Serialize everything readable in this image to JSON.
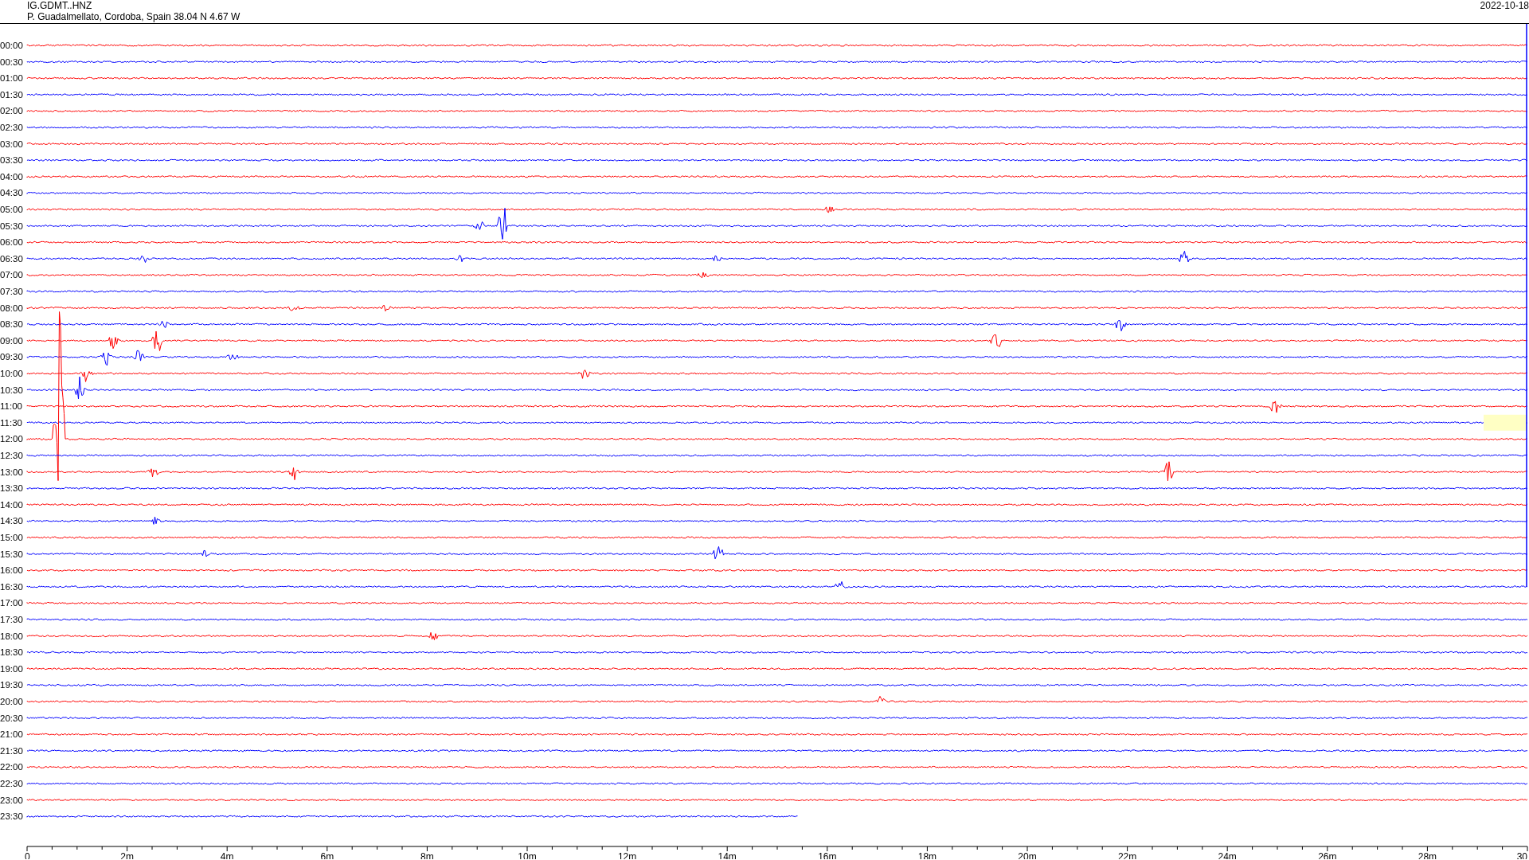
{
  "header": {
    "station": "IG.GDMT..HNZ",
    "location": "P. Guadalmellato, Cordoba, Spain  38.04 N 4.67 W",
    "date": "2022-10-18"
  },
  "rows": [
    {
      "label": "00:00",
      "color": "#ff0000"
    },
    {
      "label": "00:30",
      "color": "#0000ff"
    },
    {
      "label": "01:00",
      "color": "#ff0000"
    },
    {
      "label": "01:30",
      "color": "#0000ff"
    },
    {
      "label": "02:00",
      "color": "#ff0000"
    },
    {
      "label": "02:30",
      "color": "#0000ff"
    },
    {
      "label": "03:00",
      "color": "#ff0000"
    },
    {
      "label": "03:30",
      "color": "#0000ff"
    },
    {
      "label": "04:00",
      "color": "#ff0000"
    },
    {
      "label": "04:30",
      "color": "#0000ff"
    },
    {
      "label": "05:00",
      "color": "#ff0000"
    },
    {
      "label": "05:30",
      "color": "#0000ff"
    },
    {
      "label": "06:00",
      "color": "#ff0000"
    },
    {
      "label": "06:30",
      "color": "#0000ff"
    },
    {
      "label": "07:00",
      "color": "#ff0000"
    },
    {
      "label": "07:30",
      "color": "#0000ff"
    },
    {
      "label": "08:00",
      "color": "#ff0000"
    },
    {
      "label": "08:30",
      "color": "#0000ff"
    },
    {
      "label": "09:00",
      "color": "#ff0000"
    },
    {
      "label": "09:30",
      "color": "#0000ff"
    },
    {
      "label": "10:00",
      "color": "#ff0000"
    },
    {
      "label": "10:30",
      "color": "#0000ff"
    },
    {
      "label": "11:00",
      "color": "#ff0000"
    },
    {
      "label": "11:30",
      "color": "#0000ff"
    },
    {
      "label": "12:00",
      "color": "#ff0000"
    },
    {
      "label": "12:30",
      "color": "#0000ff"
    },
    {
      "label": "13:00",
      "color": "#ff0000"
    },
    {
      "label": "13:30",
      "color": "#0000ff"
    },
    {
      "label": "14:00",
      "color": "#ff0000"
    },
    {
      "label": "14:30",
      "color": "#0000ff"
    },
    {
      "label": "15:00",
      "color": "#ff0000"
    },
    {
      "label": "15:30",
      "color": "#0000ff"
    },
    {
      "label": "16:00",
      "color": "#ff0000"
    },
    {
      "label": "16:30",
      "color": "#0000ff"
    },
    {
      "label": "17:00",
      "color": "#ff0000"
    },
    {
      "label": "17:30",
      "color": "#0000ff"
    },
    {
      "label": "18:00",
      "color": "#ff0000"
    },
    {
      "label": "18:30",
      "color": "#0000ff"
    },
    {
      "label": "19:00",
      "color": "#ff0000"
    },
    {
      "label": "19:30",
      "color": "#0000ff"
    },
    {
      "label": "20:00",
      "color": "#ff0000"
    },
    {
      "label": "20:30",
      "color": "#0000ff"
    },
    {
      "label": "21:00",
      "color": "#ff0000"
    },
    {
      "label": "21:30",
      "color": "#0000ff"
    },
    {
      "label": "22:00",
      "color": "#ff0000"
    },
    {
      "label": "22:30",
      "color": "#0000ff"
    },
    {
      "label": "23:00",
      "color": "#ff0000"
    },
    {
      "label": "23:30",
      "color": "#0000ff"
    }
  ],
  "axis": {
    "ticks": [
      "0",
      "2m",
      "4m",
      "6m",
      "8m",
      "10m",
      "12m",
      "14m",
      "16m",
      "18m",
      "20m",
      "22m",
      "24m",
      "26m",
      "28m",
      "30"
    ]
  }
}
